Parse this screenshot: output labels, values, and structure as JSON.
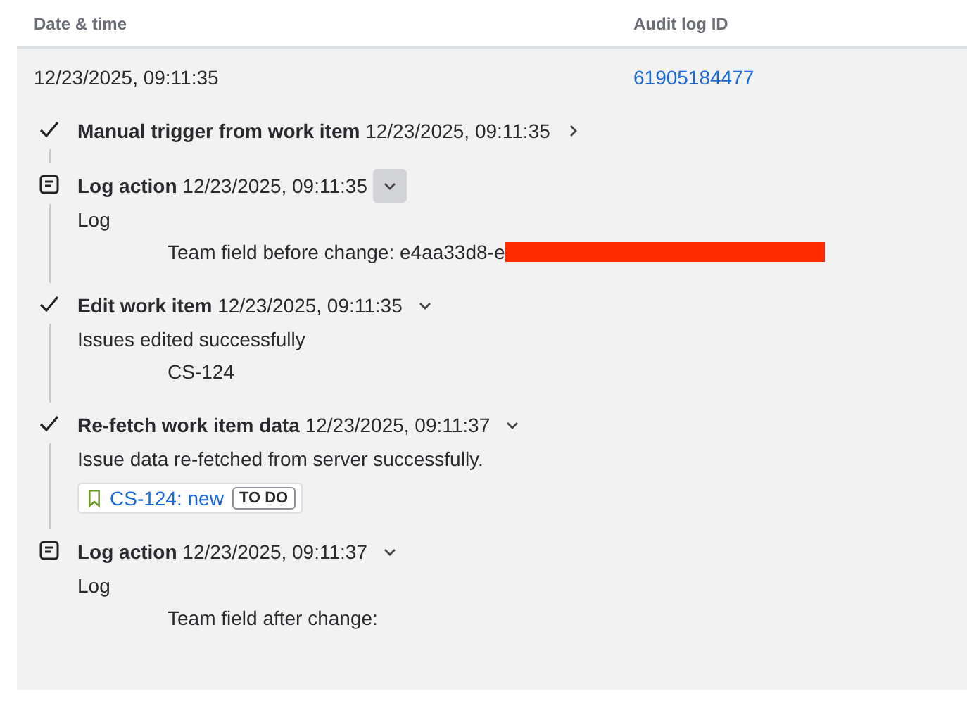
{
  "columns": [
    "Date & time",
    "Audit log ID"
  ],
  "entry": {
    "date": "12/23/2025, 09:11:35",
    "audit_id": "61905184477"
  },
  "steps": [
    {
      "kind": "check",
      "title": "Manual trigger from work item",
      "time": "12/23/2025, 09:11:35",
      "expanded": false,
      "hovered": false
    },
    {
      "kind": "log",
      "title": "Log action",
      "time": "12/23/2025, 09:11:35",
      "expanded": true,
      "hovered": true,
      "body": [
        {
          "text": "Log",
          "indent": false
        },
        {
          "text": "Team field before change: e4aa33d8-e",
          "indent": true,
          "redacted": true
        }
      ]
    },
    {
      "kind": "check",
      "title": "Edit work item",
      "time": "12/23/2025, 09:11:35",
      "expanded": true,
      "hovered": false,
      "body": [
        {
          "text": "Issues edited successfully",
          "indent": false
        },
        {
          "text": "CS-124",
          "indent": true
        }
      ]
    },
    {
      "kind": "check",
      "title": "Re-fetch work item data",
      "time": "12/23/2025, 09:11:37",
      "expanded": true,
      "hovered": false,
      "body": [
        {
          "text": "Issue data re-fetched from server successfully.",
          "indent": false
        }
      ],
      "card": {
        "link": "CS-124: new",
        "status": "TO DO"
      }
    },
    {
      "kind": "log",
      "title": "Log action",
      "time": "12/23/2025, 09:11:37",
      "expanded": true,
      "hovered": false,
      "body": [
        {
          "text": "Log",
          "indent": false
        },
        {
          "text": "Team field after change:",
          "indent": true
        }
      ]
    }
  ]
}
